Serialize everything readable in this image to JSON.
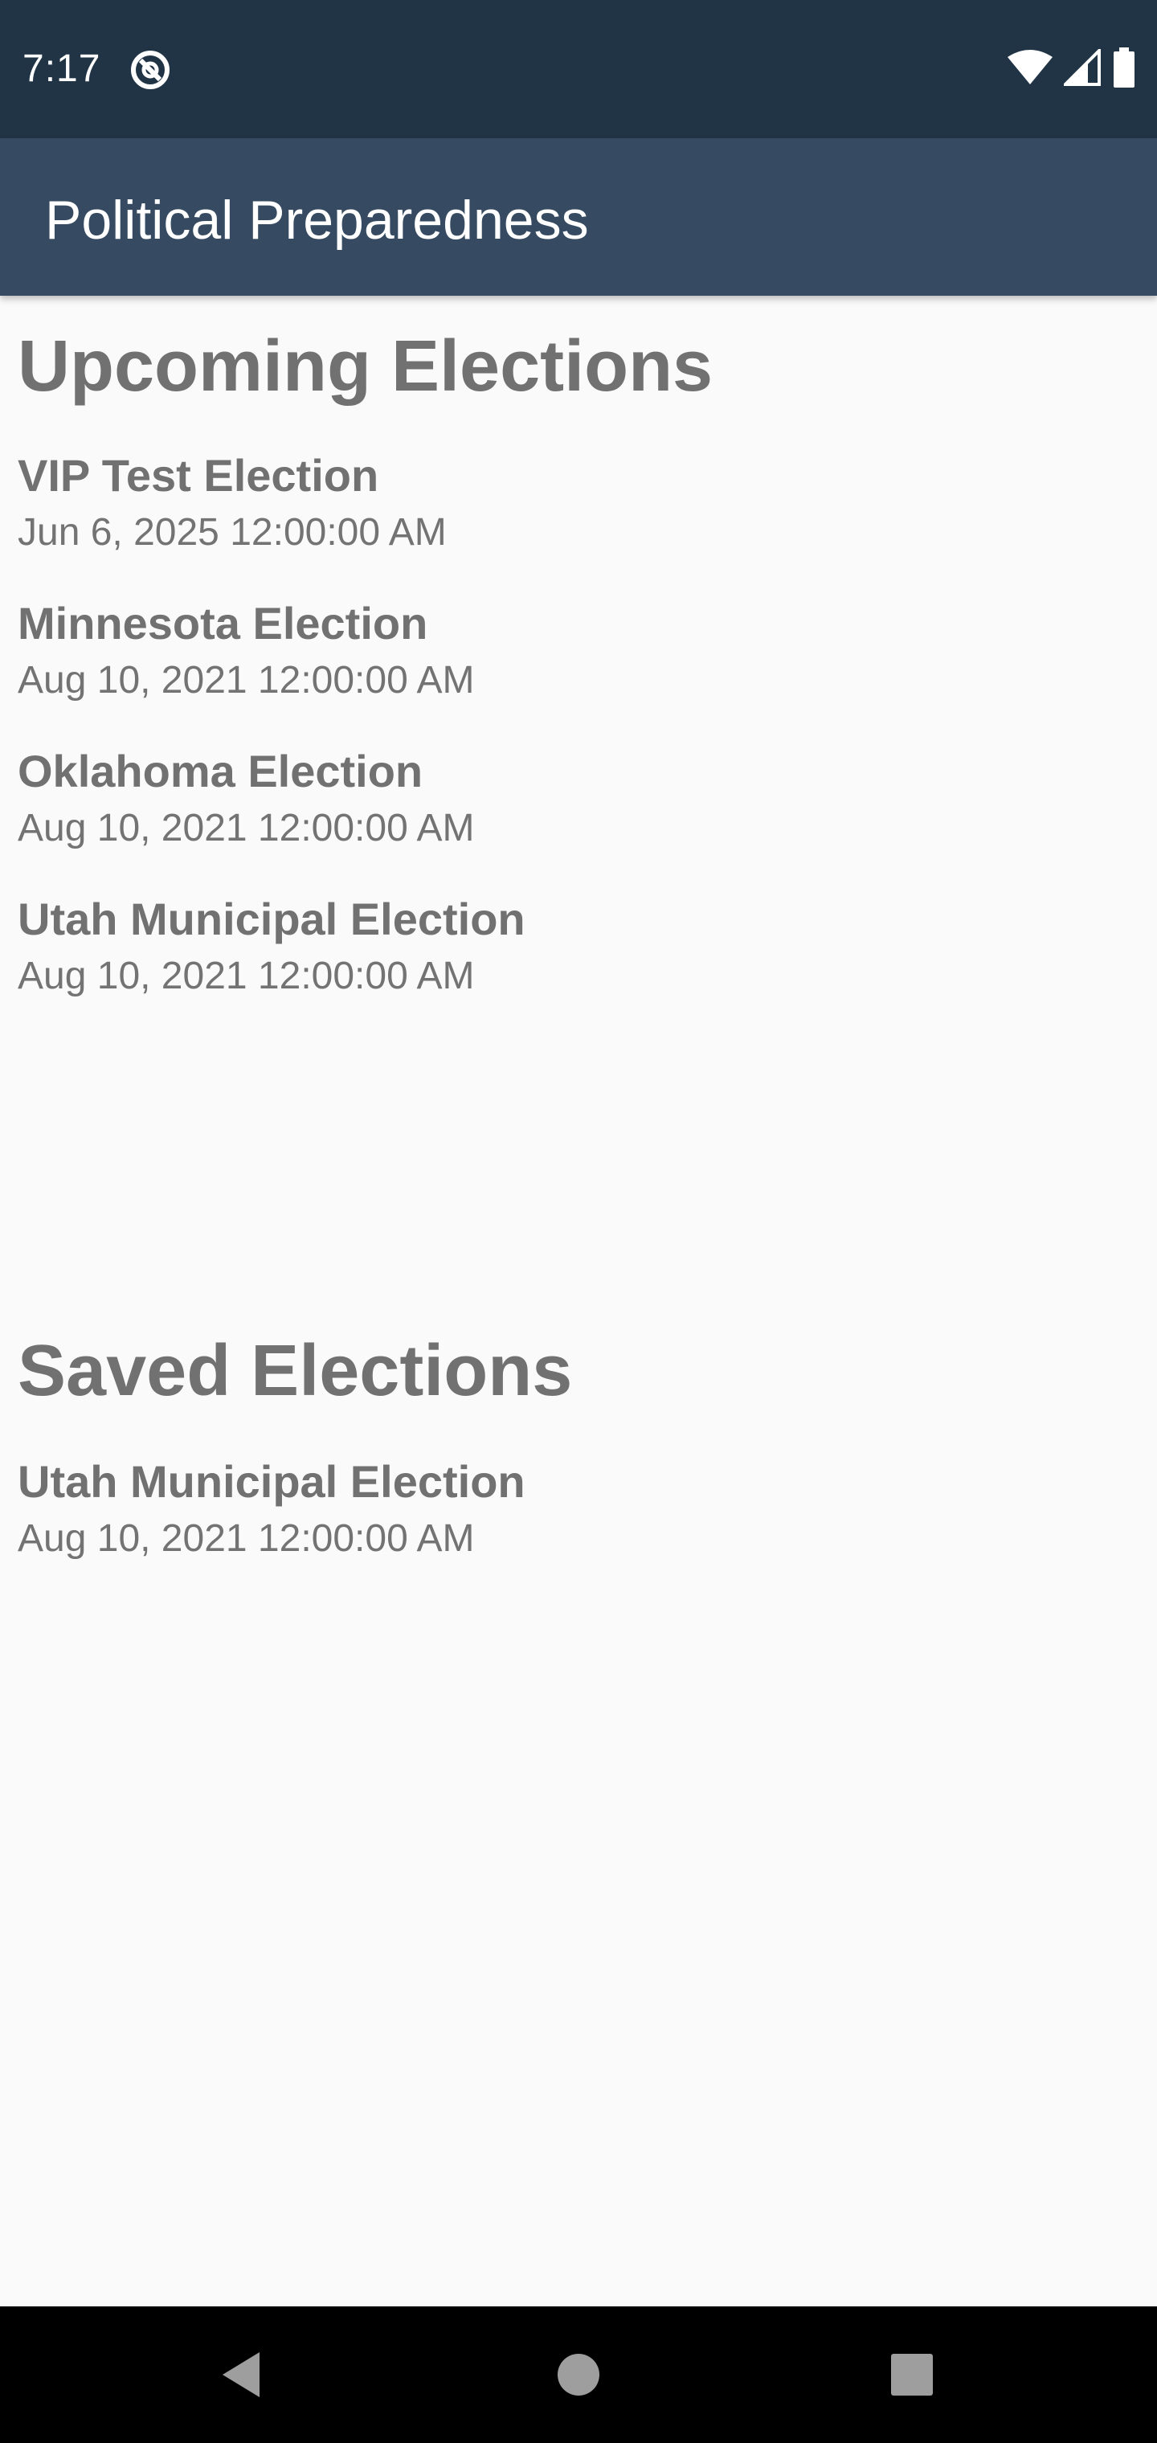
{
  "status_bar": {
    "time": "7:17",
    "icons": [
      "app-notification-icon",
      "wifi-icon",
      "signal-icon",
      "battery-icon"
    ]
  },
  "app_bar": {
    "title": "Political Preparedness"
  },
  "upcoming": {
    "heading": "Upcoming Elections",
    "items": [
      {
        "name": "VIP Test Election",
        "date": "Jun 6, 2025 12:00:00 AM"
      },
      {
        "name": "Minnesota Election",
        "date": "Aug 10, 2021 12:00:00 AM"
      },
      {
        "name": "Oklahoma Election",
        "date": "Aug 10, 2021 12:00:00 AM"
      },
      {
        "name": "Utah Municipal Election",
        "date": "Aug 10, 2021 12:00:00 AM"
      }
    ]
  },
  "saved": {
    "heading": "Saved Elections",
    "items": [
      {
        "name": "Utah Municipal Election",
        "date": "Aug 10, 2021 12:00:00 AM"
      }
    ]
  },
  "nav_bar": {
    "icons": [
      "back-icon",
      "home-icon",
      "recents-icon"
    ]
  },
  "colors": {
    "status_bar": "#213446",
    "app_bar": "#364b61",
    "background": "#fafafa",
    "text": "#717171"
  }
}
